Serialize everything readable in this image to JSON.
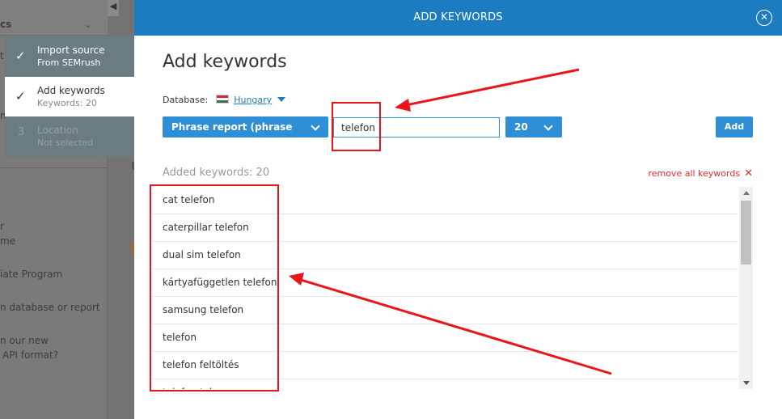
{
  "background": {
    "lines": [
      {
        "text": "cs",
        "bold": true
      },
      {
        "text": "t",
        "bold": false
      },
      {
        "text": "n",
        "bold": false
      },
      {
        "text": "r",
        "bold": false
      },
      {
        "text": "me",
        "bold": false
      },
      {
        "text": "iate Program",
        "bold": false
      },
      {
        "text": "n database or report",
        "bold": false
      },
      {
        "text": "n our new",
        "bold": false
      },
      {
        "text": "API format?",
        "bold": false
      }
    ],
    "collapse_icon": "◀"
  },
  "steps": [
    {
      "title": "Import source",
      "subtitle": "From SEMrush",
      "mark": "✓",
      "state": "done"
    },
    {
      "title": "Add keywords",
      "subtitle": "Keywords: 20",
      "mark": "✓",
      "state": "active"
    },
    {
      "title": "Location",
      "subtitle": "Not selected",
      "mark": "3",
      "state": "pending"
    }
  ],
  "modal": {
    "title": "ADD KEYWORDS",
    "close_icon": "✕",
    "heading": "Add keywords",
    "database_label": "Database:",
    "database_value": "Hungary",
    "report_type": "Phrase report (phrase match)",
    "keyword_input_value": "telefon",
    "count_value": "20",
    "add_button": "Add",
    "added_label": "Added keywords: 20",
    "remove_all": "remove all keywords",
    "remove_all_icon": "✕",
    "keywords": [
      "cat telefon",
      "caterpillar telefon",
      "dual sim telefon",
      "kártyafüggetlen telefon",
      "samsung telefon",
      "telefon",
      "telefon feltöltés",
      "telefon tok"
    ]
  },
  "colors": {
    "header_blue": "#1d7bc0",
    "button_blue": "#2f8fd6",
    "annotation_red": "#e8161b",
    "remove_red": "#d9302c",
    "flag_red": "#cd2a3e",
    "flag_white": "#ffffff",
    "flag_green": "#436f4d"
  }
}
